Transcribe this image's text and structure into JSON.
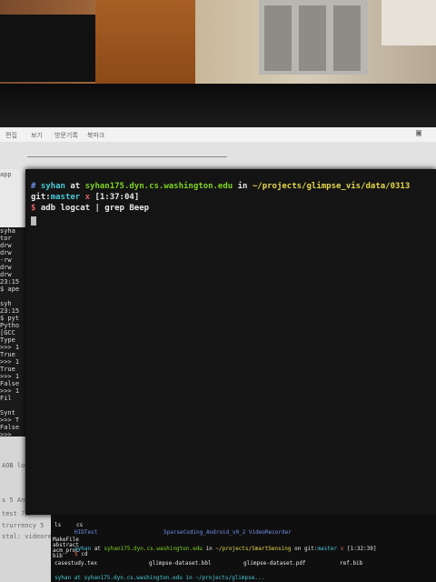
{
  "room": {
    "colors": {
      "door": "#a85f24",
      "wall": "#d8cdb8",
      "monitor_bezel": "#111111"
    }
  },
  "menubar": {
    "items": [
      "편집",
      "보기",
      "방문기록",
      "북마크"
    ]
  },
  "left_note": "app",
  "left_terminal": {
    "lines": [
      "syha",
      "tor",
      "drw",
      "drw",
      "-rw",
      "drw",
      "drw",
      "23:15",
      "$ ape",
      "",
      "syh",
      "23:15",
      "$ pyt",
      "Pytho",
      "[GCC",
      "Type",
      ">>> 1",
      "True",
      ">>> 1",
      "True",
      ">>> 1",
      "False",
      ">>> 1",
      "Fil",
      "",
      "Synt",
      ">>> T",
      "False",
      ">>> "
    ]
  },
  "sidebar": {
    "items": [
      "AOB log",
      "s 5 And",
      "test 기2",
      "trurrency 5",
      "stal: videoreco"
    ]
  },
  "terminal": {
    "prompt_user": "syhan",
    "at_word": "at",
    "host": "syhan175.dyn.cs.washington.edu",
    "in_word": "in",
    "path": "~/projects/glimpse_vis/data/0313",
    "git_label": "git:",
    "branch": "master",
    "dirty_mark": "x",
    "time": "[1:37:04]",
    "command_sym": "$",
    "command": "adb logcat  | grep Beep"
  },
  "bottom_terminal": {
    "ls_line": "ls",
    "ls_col2": "cs",
    "file_a": "HIDTest",
    "file_b": "SparseCoding_Android_v0_2 VideoRecorder",
    "side_labels": [
      "MakeFile",
      "abstract",
      "acm_proc",
      "bib"
    ],
    "prompt_user": "syhan",
    "at_word": "at",
    "host": "syhan175.dyn.cs.washington.edu",
    "in_word": "in",
    "path": "~/projects/SmartSensing",
    "on_word": "on",
    "git_label": "git:",
    "branch": "master",
    "dirty_mark": "x",
    "time": "[1:32:39]",
    "command_sym": "$",
    "command": "cd",
    "files": [
      "casestudy.tex",
      "glimpse-dataset.bbl",
      "glimpse-dataset.pdf",
      "ref.bib"
    ],
    "last_line": "syhan at syhan175.dyn.cs.washington.edu in ~/projects/glimpse..."
  }
}
